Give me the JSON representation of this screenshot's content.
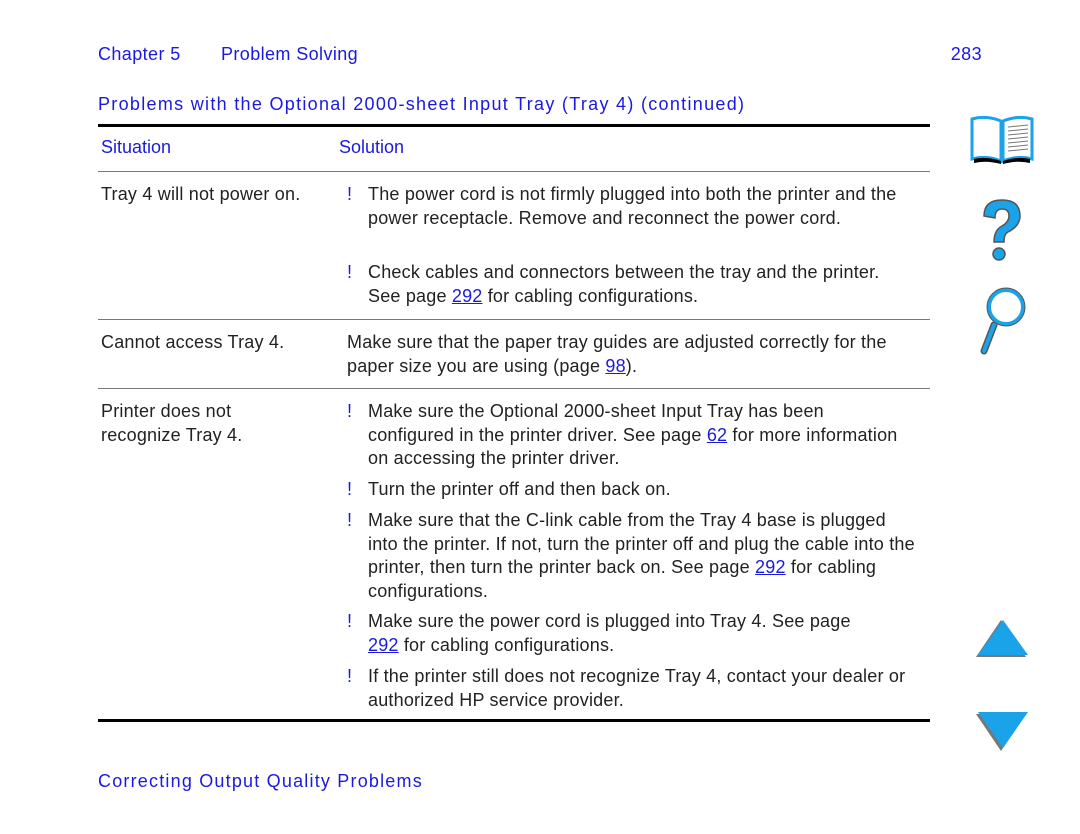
{
  "header": {
    "chapter": "Chapter 5",
    "section": "Problem Solving",
    "page_number": "283"
  },
  "title": "Problems with the Optional 2000-sheet Input Tray (Tray 4) (continued)",
  "table": {
    "columns": [
      "Situation",
      "Solution"
    ],
    "rows": [
      {
        "situation": "Tray 4 will not power on.",
        "items": [
          {
            "bullet": "!",
            "text": "The power cord is not firmly plugged into both the printer and the power receptacle. Remove and reconnect the power cord."
          },
          {
            "bullet": "!",
            "pre": "Check cables and connectors between the tray and the printer. See page ",
            "link": "292",
            "post": " for cabling configurations."
          }
        ]
      },
      {
        "situation": "Cannot access Tray 4.",
        "items": [
          {
            "bullet": "",
            "pre": "Make sure that the paper tray guides are adjusted correctly for the paper size you are using (page ",
            "link": "98",
            "post": ")."
          }
        ]
      },
      {
        "situation": "Printer does not recognize Tray 4.",
        "items": [
          {
            "bullet": "!",
            "pre": "Make sure the Optional 2000-sheet Input Tray has been configured in the printer driver. See page ",
            "link": "62",
            "post": " for more information on accessing the printer driver."
          },
          {
            "bullet": "!",
            "text": "Turn the printer off and then back on."
          },
          {
            "bullet": "!",
            "pre": "Make sure that the C-link cable from the Tray 4 base is plugged into the printer. If not, turn the printer off and plug the cable into the printer, then turn the printer back on. See page ",
            "link": "292",
            "post": " for cabling configurations."
          },
          {
            "bullet": "!",
            "pre": "Make sure the power cord is plugged into Tray 4. See page ",
            "link": "292",
            "post": " for cabling configurations."
          },
          {
            "bullet": "!",
            "text": "If the printer still does not recognize Tray 4, contact your dealer or authorized HP service provider."
          }
        ]
      }
    ]
  },
  "footer_link": "Correcting Output Quality Problems",
  "side_nav": [
    "contents-book-icon",
    "help-question-icon",
    "search-magnifier-icon",
    "previous-page-arrow-icon",
    "next-page-arrow-icon"
  ],
  "colors": {
    "link_blue": "#1a1adf",
    "icon_blue": "#1aa3e8"
  }
}
